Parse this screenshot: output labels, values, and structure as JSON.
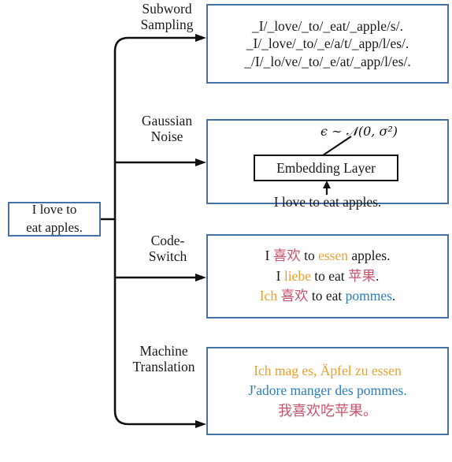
{
  "input": {
    "name": "source-sentence",
    "text_line1": "I love to",
    "text_line2": "eat apples."
  },
  "branches": [
    {
      "id": "subword-sampling",
      "label": "Subword\nSampling"
    },
    {
      "id": "gaussian-noise",
      "label": "Gaussian\nNoise"
    },
    {
      "id": "code-switch",
      "label": "Code-\nSwitch"
    },
    {
      "id": "machine-translation",
      "label": "Machine\nTranslation"
    }
  ],
  "subword": {
    "line1": "_I/_love/_to/_eat/_apple/s/.",
    "line2": "_I/_love/_to/_e/a/t/_app/l/es/.",
    "line3": "_/I/_lo/ve/_to/_e/at/_app/l/es/."
  },
  "gaussian": {
    "formula": "ϵ ∼ 𝒩(0, σ²)",
    "embedding_layer": "Embedding Layer",
    "input_sentence": "I love to eat apples."
  },
  "code_switch": {
    "line1": {
      "a": "I ",
      "b": "喜欢",
      "c": " to ",
      "d": "essen",
      "e": " apples."
    },
    "line2": {
      "a": "I ",
      "b": "liebe",
      "c": " to eat ",
      "d": "苹果",
      "e": "."
    },
    "line3": {
      "a": "Ich ",
      "b": "喜欢",
      "c": " to eat ",
      "d": "pommes",
      "e": "."
    }
  },
  "machine_translation": {
    "german": "Ich mag es, Äpfel zu essen",
    "french": "J'adore manger des pommes.",
    "chinese": "我喜欢吃苹果。"
  },
  "colors": {
    "box_border": "#4472a8",
    "connector": "#111111",
    "chinese": "#c4566e",
    "german": "#e5a231",
    "french": "#2d7fb8",
    "text": "#1a1a1a"
  }
}
